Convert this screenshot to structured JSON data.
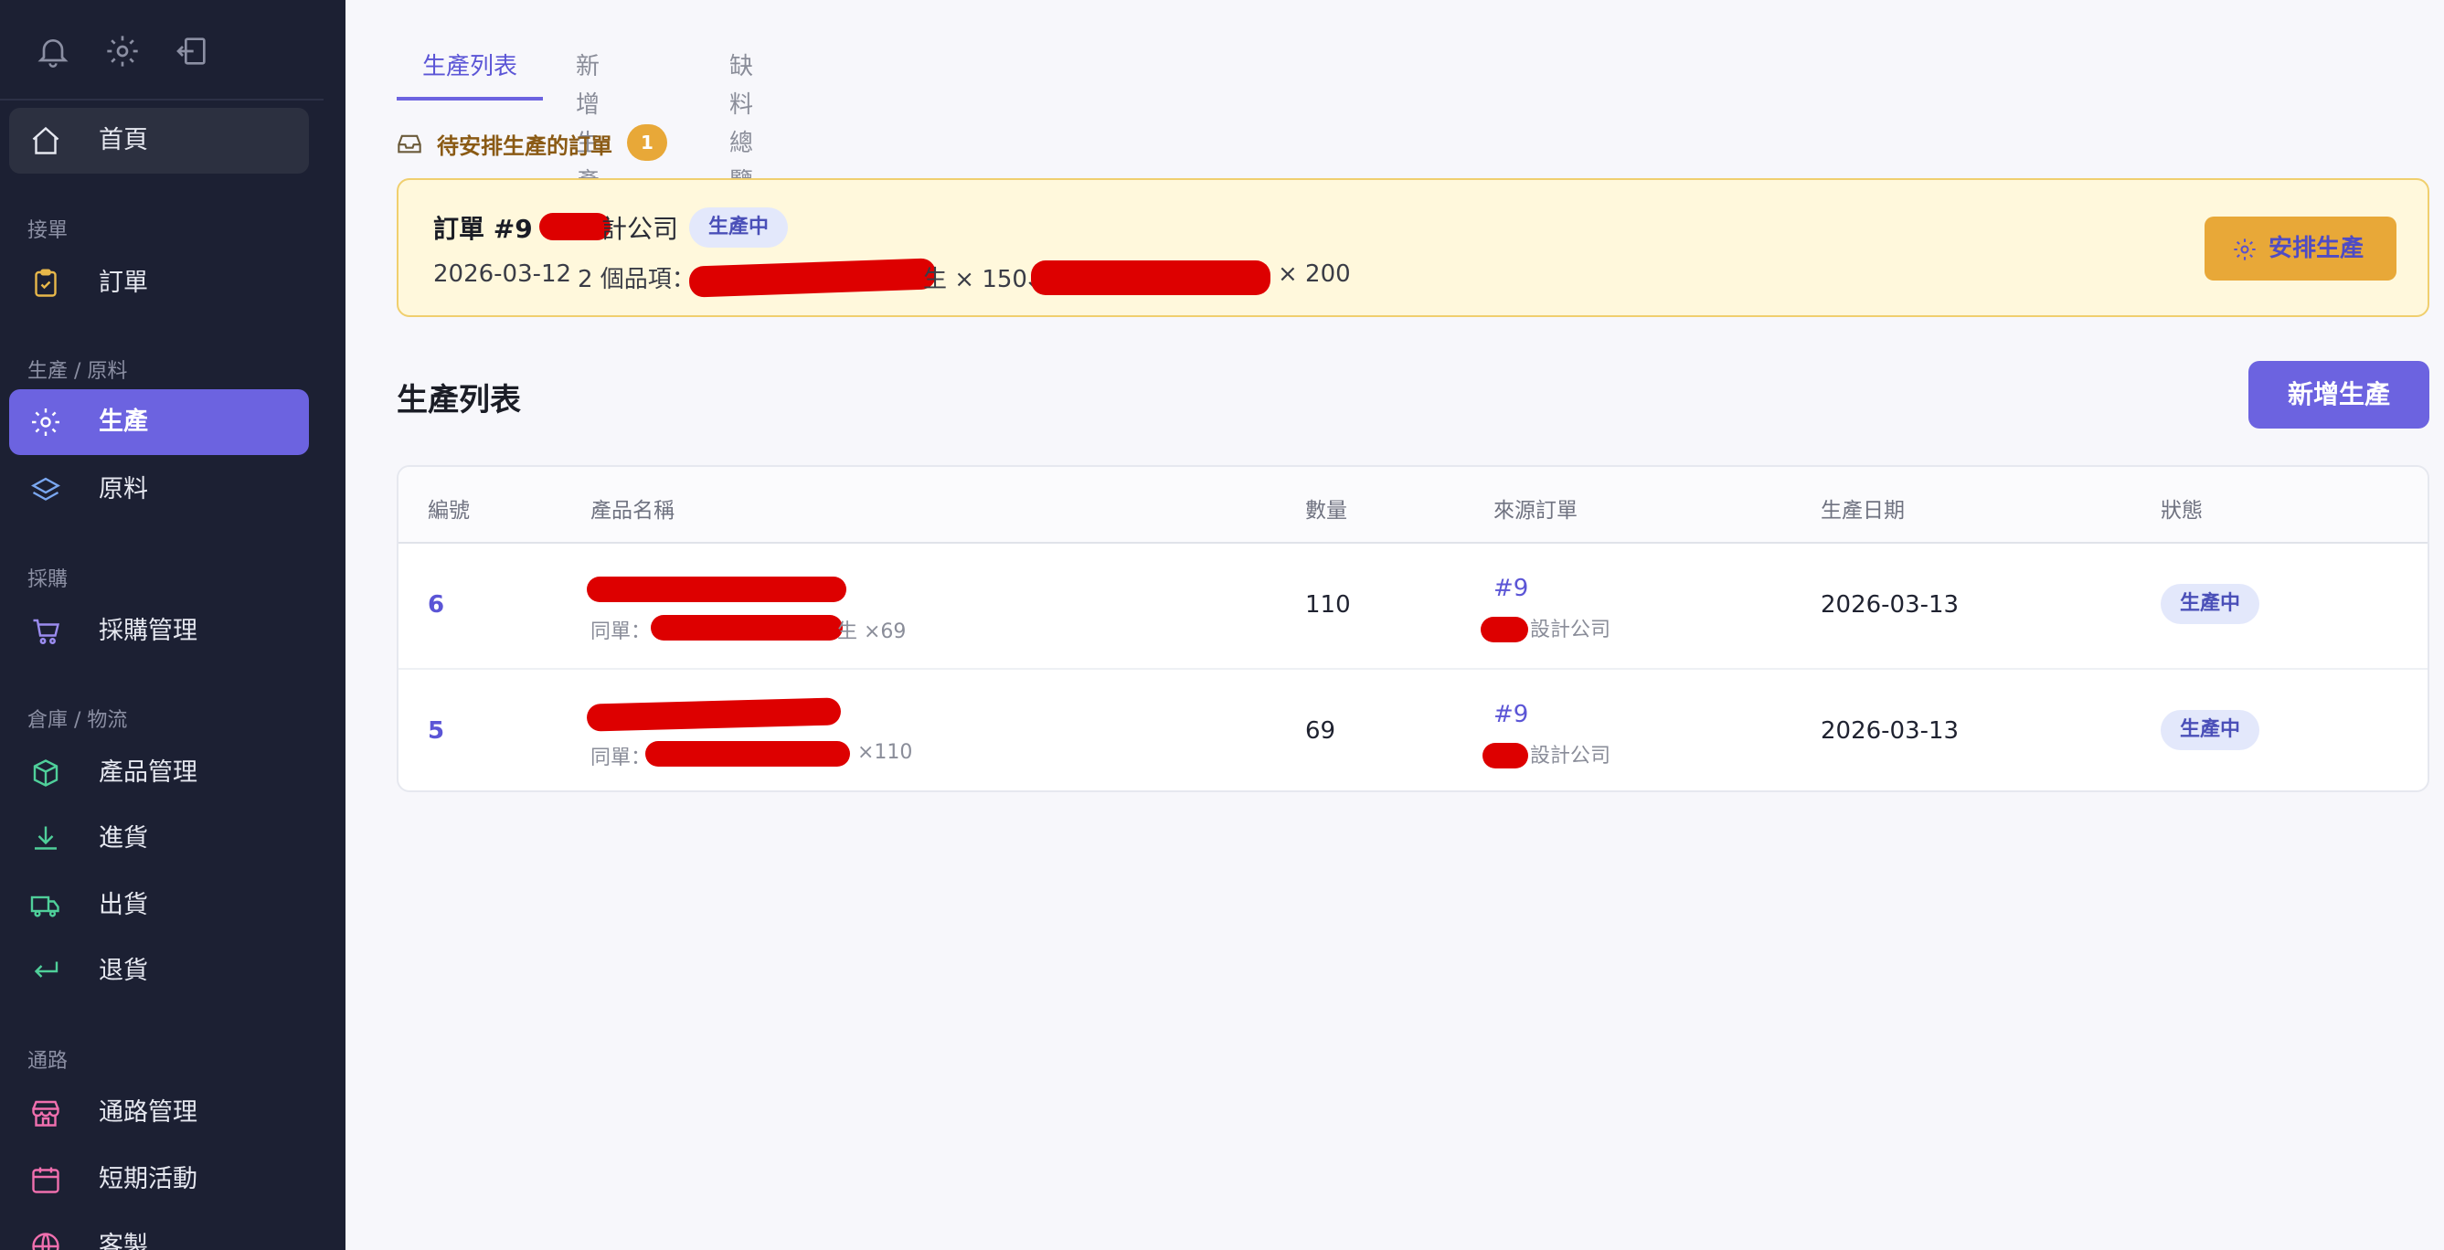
{
  "sidebar": {
    "top_icons": [
      "bell-icon",
      "gear-icon",
      "logout-icon"
    ],
    "home": "首頁",
    "sections": {
      "orders": "接單",
      "production": "生產 / 原料",
      "purchase": "採購",
      "warehouse": "倉庫 / 物流",
      "channel": "通路"
    },
    "items": {
      "orders": "訂單",
      "production": "生產",
      "materials": "原料",
      "purchase": "採購管理",
      "products": "產品管理",
      "inbound": "進貨",
      "outbound": "出貨",
      "returns": "退貨",
      "channel": "通路管理",
      "events": "短期活動",
      "custom": "客製"
    }
  },
  "tabs": [
    "生產列表",
    "新增生產",
    "缺料總覽"
  ],
  "pending": {
    "label": "待安排生產的訂單",
    "count": "1"
  },
  "order_card": {
    "title": "訂單 #9",
    "company": "計公司",
    "status": "生產中",
    "date": "2026-03-12",
    "items_prefix": "2 個品項：",
    "item1_suffix": "生 × 150、",
    "item2_suffix": "× 200",
    "arrange_label": "安排生產"
  },
  "list": {
    "title": "生產列表",
    "add_label": "新增生產",
    "columns": [
      "編號",
      "產品名稱",
      "數量",
      "來源訂單",
      "生產日期",
      "狀態"
    ],
    "rows": [
      {
        "id": "6",
        "same_order_prefix": "同單：",
        "same_order_suffix": "生 ×69",
        "qty": "110",
        "order_link": "#9",
        "order_company": "設計公司",
        "date": "2026-03-13",
        "status": "生產中"
      },
      {
        "id": "5",
        "same_order_prefix": "同單：",
        "same_order_suffix": "×110",
        "qty": "69",
        "order_link": "#9",
        "order_company": "設計公司",
        "date": "2026-03-13",
        "status": "生產中"
      }
    ]
  },
  "colors": {
    "sidebar_bg": "#1c2033",
    "accent": "#6c63e0",
    "warning": "#e8a838",
    "redaction": "#dd0000"
  }
}
